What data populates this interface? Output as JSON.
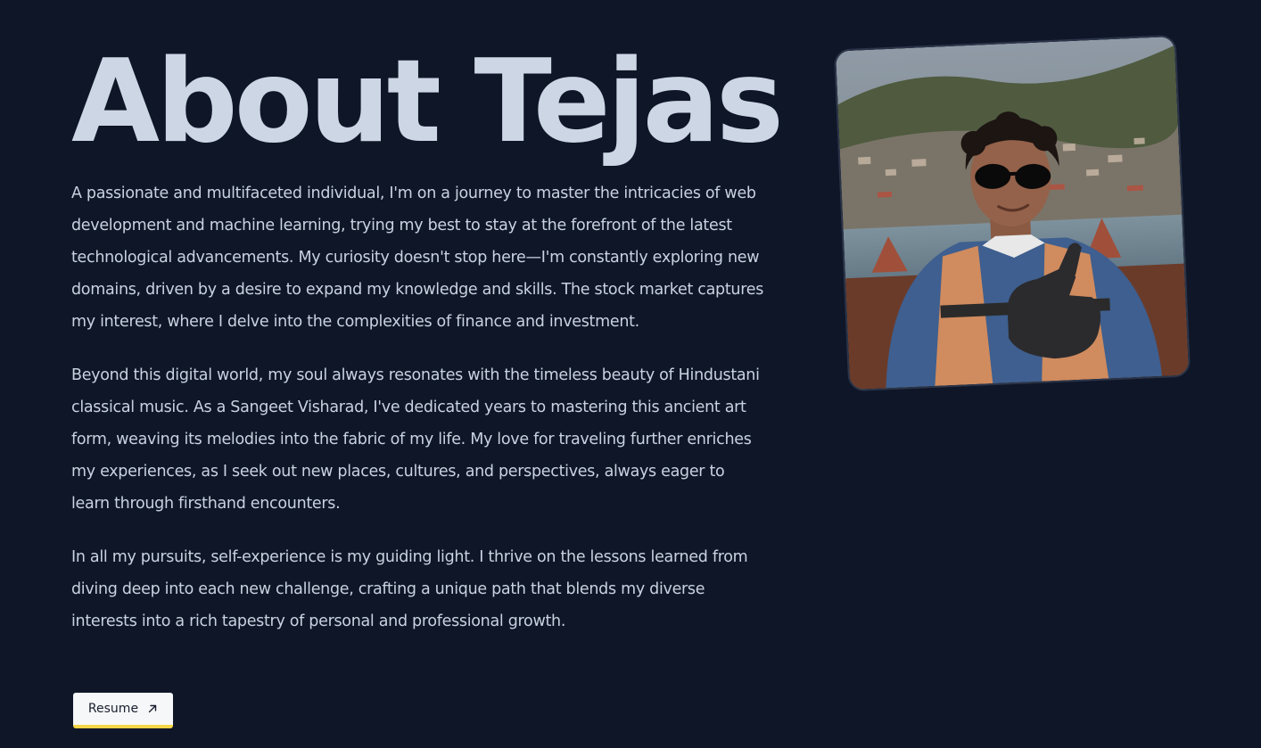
{
  "title": "About Tejas",
  "paragraphs": [
    "A passionate and multifaceted individual, I'm on a journey to master the intricacies of web development and machine learning, trying my best to stay at the forefront of the latest technological advancements. My curiosity doesn't stop here—I'm constantly exploring new domains, driven by a desire to expand my knowledge and skills. The stock market captures my interest, where I delve into the complexities of finance and investment.",
    "Beyond this digital world, my soul always resonates with the timeless beauty of Hindustani classical music. As a Sangeet Visharad, I've dedicated years to mastering this ancient art form, weaving its melodies into the fabric of my life. My love for traveling further enriches my experiences, as I seek out new places, cultures, and perspectives, always eager to learn through firsthand encounters.",
    "In all my pursuits, self-experience is my guiding light. I thrive on the lessons learned from diving deep into each new challenge, crafting a unique path that blends my diverse interests into a rich tapestry of personal and professional growth."
  ],
  "resume": {
    "label": "Resume",
    "icon": "arrow-up-right-icon"
  },
  "photo": {
    "subject": "profile-photo"
  },
  "colors": {
    "background": "#0e1628",
    "title": "#cdd6e4",
    "text": "#c9d2e0",
    "button_bg": "#f6f7f9",
    "button_accent": "#f5d547"
  }
}
